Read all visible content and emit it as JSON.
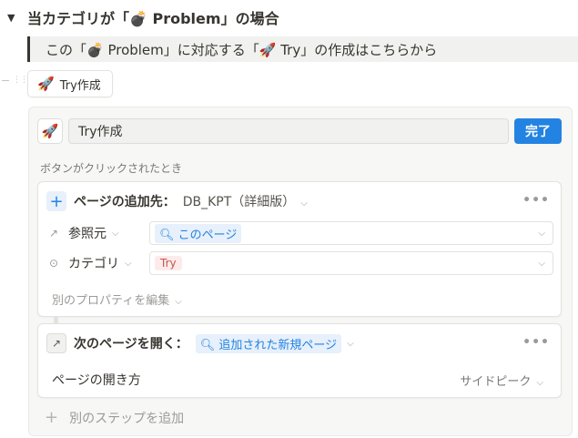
{
  "heading": {
    "arrow": "▼",
    "text": "当カテゴリが「💣 Problem」の場合"
  },
  "quote": {
    "text": "この「💣 Problem」に対応する「🚀 Try」の作成はこちらから"
  },
  "button_block": {
    "icon": "🚀",
    "label": "Try作成"
  },
  "editor": {
    "icon": "🚀",
    "name_value": "Try作成",
    "done_label": "完了",
    "trigger_label": "ボタンがクリックされたとき",
    "step1": {
      "title": "ページの追加先：",
      "target": "DB_KPT（詳細版）",
      "more": "•••",
      "properties": [
        {
          "icon": "↗",
          "name": "参照元",
          "value": "このページ",
          "value_icon": "search-icon"
        },
        {
          "icon": "⊙",
          "name": "カテゴリ",
          "value": "Try"
        }
      ],
      "edit_label": "別のプロパティを編集"
    },
    "step2": {
      "title": "次のページを開く：",
      "target": "追加された新規ページ",
      "more": "•••",
      "open_label": "ページの開き方",
      "open_value": "サイドピーク"
    },
    "add_step_label": "別のステップを追加"
  },
  "colors": {
    "accent": "#2383e2",
    "tag_red_bg": "#fdebec",
    "tag_blue_bg": "#e7f0fb"
  }
}
